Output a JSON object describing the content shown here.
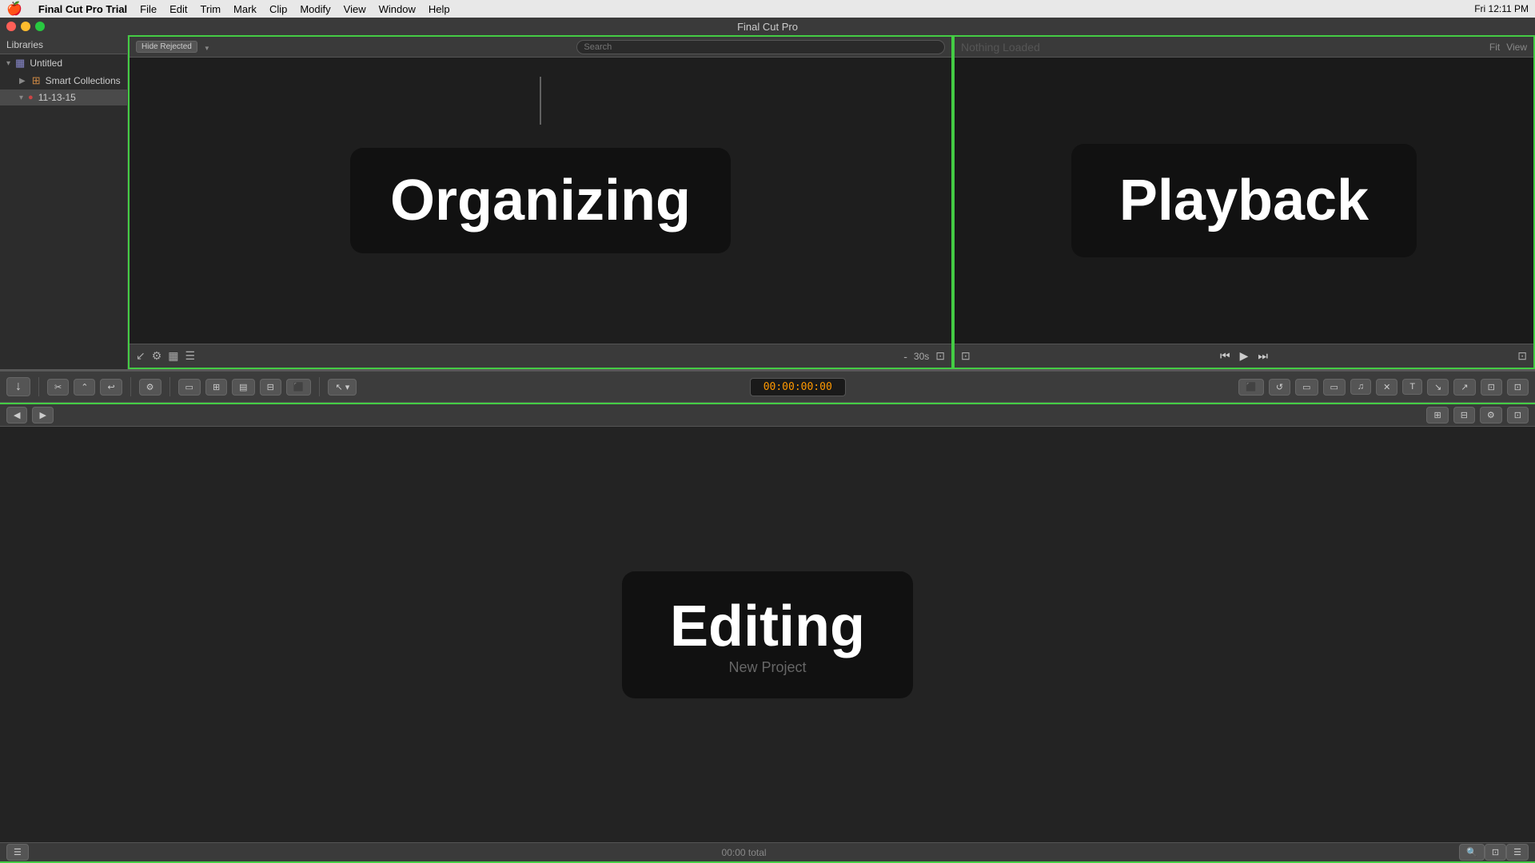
{
  "menubar": {
    "apple": "🍎",
    "app_name": "Final Cut Pro Trial",
    "menus": [
      "File",
      "Edit",
      "Trim",
      "Mark",
      "Clip",
      "Modify",
      "View",
      "Window",
      "Help"
    ],
    "title": "Final Cut Pro",
    "time": "Fri 12:11 PM"
  },
  "library": {
    "header": "Libraries",
    "items": [
      {
        "label": "Untitled",
        "type": "library",
        "expanded": true
      },
      {
        "label": "Smart Collections",
        "type": "smart",
        "indent": 1
      },
      {
        "label": "11-13-15",
        "type": "event",
        "indent": 1,
        "selected": true
      }
    ]
  },
  "browser": {
    "filter_label": "Hide Rejected",
    "content_label": "Organizing",
    "footer_duration": "30s"
  },
  "viewer": {
    "status": "Nothing Loaded",
    "content_label": "Playback",
    "fit_label": "Fit",
    "view_label": "View"
  },
  "toolbar": {
    "import_label": "↓",
    "timecode": "00:00:00:00"
  },
  "timeline": {
    "content_label": "Editing",
    "content_sub": "New Project",
    "footer_label": "00:00 total"
  }
}
